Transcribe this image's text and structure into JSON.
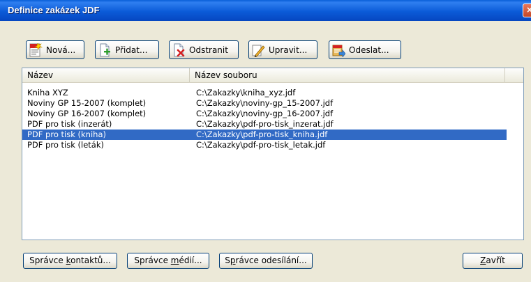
{
  "window": {
    "title": "Definice zakázek JDF",
    "close_glyph": "×"
  },
  "toolbar": {
    "new_label": "Nová...",
    "add_label": "Přidat...",
    "remove_label": "Odstranit",
    "edit_label": "Upravit...",
    "send_label": "Odeslat..."
  },
  "list": {
    "columns": [
      "Název",
      "Název souboru"
    ],
    "selected_index": 4,
    "rows": [
      {
        "name": "Kniha XYZ",
        "file": "C:\\Zakazky\\kniha_xyz.jdf"
      },
      {
        "name": "Noviny GP 15-2007 (komplet)",
        "file": "C:\\Zakazky\\noviny-gp_15-2007.jdf"
      },
      {
        "name": "Noviny GP 16-2007 (komplet)",
        "file": "C:\\Zakazky\\noviny-gp_16-2007.jdf"
      },
      {
        "name": "PDF pro tisk (inzerát)",
        "file": "C:\\Zakazky\\pdf-pro-tisk_inzerat.jdf"
      },
      {
        "name": "PDF pro tisk (kniha)",
        "file": "C:\\Zakazky\\pdf-pro-tisk_kniha.jdf"
      },
      {
        "name": "PDF pro tisk (leták)",
        "file": "C:\\Zakazky\\pdf-pro-tisk_letak.jdf"
      }
    ]
  },
  "bottom": {
    "contacts": {
      "before": "Správce ",
      "accel": "k",
      "after": "ontaktů..."
    },
    "media": {
      "before": "Správce ",
      "accel": "m",
      "after": "édií..."
    },
    "sending": {
      "before": "S",
      "accel": "p",
      "after": "rávce odesílání..."
    },
    "close": {
      "before": "",
      "accel": "Z",
      "after": "avřít"
    }
  },
  "colors": {
    "title_bar": "#0b5bd8",
    "selection": "#316ac5",
    "dialog_bg": "#ece9d8"
  },
  "icons": [
    "new-job-icon",
    "add-icon",
    "remove-icon",
    "edit-icon",
    "send-icon",
    "close-icon"
  ]
}
